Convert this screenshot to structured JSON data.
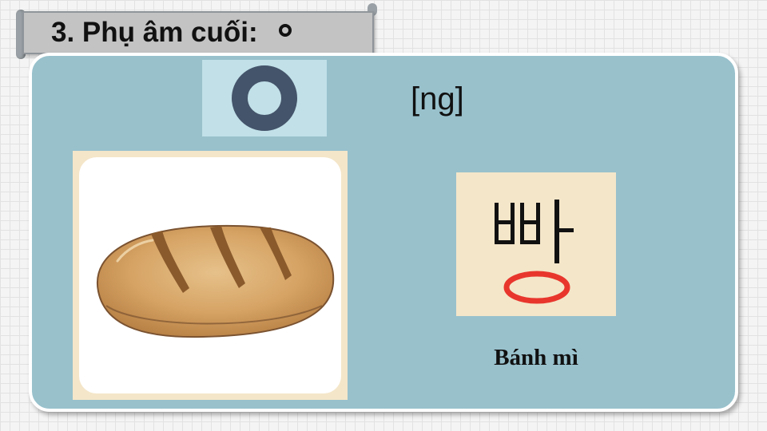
{
  "title": {
    "text": "3. Phụ âm cuối:",
    "jamo_icon": "hangul-ieung-circle"
  },
  "main": {
    "jamo_icon": "hangul-ieung-large",
    "sound": "[ng]",
    "picture_icon": "bread-loaf",
    "word_icon": "hangul-ppang",
    "caption": "Bánh mì"
  },
  "colors": {
    "background": "#f4f4f4",
    "banner": "#c3c3c3",
    "panel": "#98c1cc",
    "jamo_box": "#c1e0e8",
    "jamo": "#44546a",
    "card": "#f4e6c9",
    "final_consonant": "#e8362d"
  }
}
